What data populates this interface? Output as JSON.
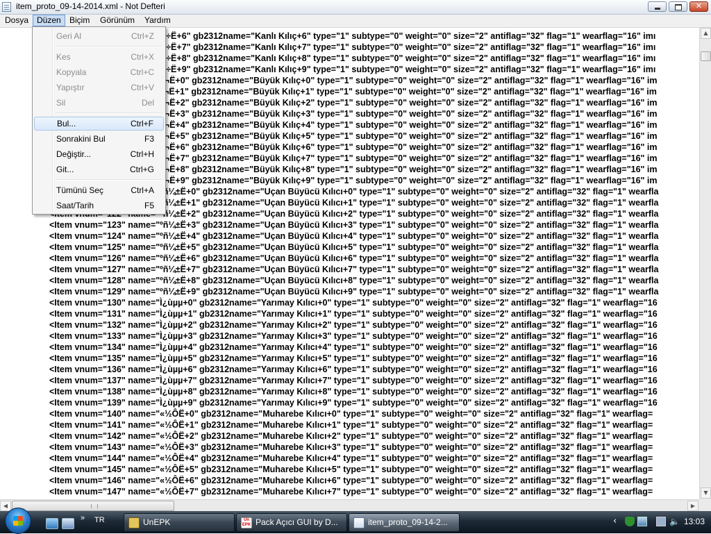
{
  "window": {
    "title": "item_proto_09-14-2014.xml - Not Defteri"
  },
  "menubar": [
    "Dosya",
    "Düzen",
    "Biçim",
    "Görünüm",
    "Yardım"
  ],
  "edit_menu": [
    {
      "label": "Geri Al",
      "shortcut": "Ctrl+Z",
      "state": "disabled"
    },
    {
      "label": "Kes",
      "shortcut": "Ctrl+X",
      "state": "disabled"
    },
    {
      "label": "Kopyala",
      "shortcut": "Ctrl+C",
      "state": "disabled"
    },
    {
      "label": "Yapıştır",
      "shortcut": "Ctrl+V",
      "state": "disabled"
    },
    {
      "label": "Sil",
      "shortcut": "Del",
      "state": "disabled"
    },
    {
      "label": "Bul...",
      "shortcut": "Ctrl+F",
      "state": "highlighted"
    },
    {
      "label": "Sonrakini Bul",
      "shortcut": "F3",
      "state": "enabled"
    },
    {
      "label": "Değiştir...",
      "shortcut": "Ctrl+H",
      "state": "enabled"
    },
    {
      "label": "Git...",
      "shortcut": "Ctrl+G",
      "state": "enabled"
    },
    {
      "label": "Tümünü Seç",
      "shortcut": "Ctrl+A",
      "state": "enabled"
    },
    {
      "label": "Saat/Tarih",
      "shortcut": "F5",
      "state": "enabled"
    }
  ],
  "editor_lines": [
    "<Item vnum=\"106\" name=\"Ç÷Ë+6\" gb2312name=\"Kanlı Kılıç+6\" type=\"1\" subtype=\"0\" weight=\"0\" size=\"2\" antiflag=\"32\" flag=\"1\" wearflag=\"16\" imı",
    "<Item vnum=\"107\" name=\"Ç÷Ë+7\" gb2312name=\"Kanlı Kılıç+7\" type=\"1\" subtype=\"0\" weight=\"0\" size=\"2\" antiflag=\"32\" flag=\"1\" wearflag=\"16\" imı",
    "<Item vnum=\"108\" name=\"Ç÷Ë+8\" gb2312name=\"Kanlı Kılıç+8\" type=\"1\" subtype=\"0\" weight=\"0\" size=\"2\" antiflag=\"32\" flag=\"1\" wearflag=\"16\" imı",
    "<Item vnum=\"109\" name=\"Ç÷Ë+9\" gb2312name=\"Kanlı Kılıç+9\" type=\"1\" subtype=\"0\" weight=\"0\" size=\"2\" antiflag=\"32\" flag=\"1\" wearflag=\"16\" imı",
    "<Item vnum=\"110\" name=\"¬¬Ë+0\" gb2312name=\"Büyük Kılıç+0\" type=\"1\" subtype=\"0\" weight=\"0\" size=\"2\" antiflag=\"32\" flag=\"1\" wearflag=\"16\" im",
    "<Item vnum=\"111\" name=\"¬¬Ë+1\" gb2312name=\"Büyük Kılıç+1\" type=\"1\" subtype=\"0\" weight=\"0\" size=\"2\" antiflag=\"32\" flag=\"1\" wearflag=\"16\" im",
    "<Item vnum=\"112\" name=\"¬¬Ë+2\" gb2312name=\"Büyük Kılıç+2\" type=\"1\" subtype=\"0\" weight=\"0\" size=\"2\" antiflag=\"32\" flag=\"1\" wearflag=\"16\" im",
    "<Item vnum=\"113\" name=\"¬¬Ë+3\" gb2312name=\"Büyük Kılıç+3\" type=\"1\" subtype=\"0\" weight=\"0\" size=\"2\" antiflag=\"32\" flag=\"1\" wearflag=\"16\" im",
    "<Item vnum=\"114\" name=\"¬¬Ë+4\" gb2312name=\"Büyük Kılıç+4\" type=\"1\" subtype=\"0\" weight=\"0\" size=\"2\" antiflag=\"32\" flag=\"1\" wearflag=\"16\" im",
    "<Item vnum=\"115\" name=\"¬¬Ë+5\" gb2312name=\"Büyük Kılıç+5\" type=\"1\" subtype=\"0\" weight=\"0\" size=\"2\" antiflag=\"32\" flag=\"1\" wearflag=\"16\" im",
    "<Item vnum=\"116\" name=\"¬¬Ë+6\" gb2312name=\"Büyük Kılıç+6\" type=\"1\" subtype=\"0\" weight=\"0\" size=\"2\" antiflag=\"32\" flag=\"1\" wearflag=\"16\" im",
    "<Item vnum=\"117\" name=\"¬¬Ë+7\" gb2312name=\"Büyük Kılıç+7\" type=\"1\" subtype=\"0\" weight=\"0\" size=\"2\" antiflag=\"32\" flag=\"1\" wearflag=\"16\" im",
    "<Item vnum=\"118\" name=\"¬¬Ë+8\" gb2312name=\"Büyük Kılıç+8\" type=\"1\" subtype=\"0\" weight=\"0\" size=\"2\" antiflag=\"32\" flag=\"1\" wearflag=\"16\" im",
    "<Item vnum=\"119\" name=\"¬¬Ë+9\" gb2312name=\"Büyük Kılıç+9\" type=\"1\" subtype=\"0\" weight=\"0\" size=\"2\" antiflag=\"32\" flag=\"1\" wearflag=\"16\" im",
    "<Item vnum=\"120\" name=\"ºñ¼±Ë+0\" gb2312name=\"Uçan Büyücü Kılıcı+0\" type=\"1\" subtype=\"0\" weight=\"0\" size=\"2\" antiflag=\"32\" flag=\"1\" wearfla",
    "<Item vnum=\"121\" name=\"ºñ¼±Ë+1\" gb2312name=\"Uçan Büyücü Kılıcı+1\" type=\"1\" subtype=\"0\" weight=\"0\" size=\"2\" antiflag=\"32\" flag=\"1\" wearfla",
    "<Item vnum=\"122\" name=\"ºñ¼±Ë+2\" gb2312name=\"Uçan Büyücü Kılıcı+2\" type=\"1\" subtype=\"0\" weight=\"0\" size=\"2\" antiflag=\"32\" flag=\"1\" wearfla",
    "<Item vnum=\"123\" name=\"ºñ¼±Ë+3\" gb2312name=\"Uçan Büyücü Kılıcı+3\" type=\"1\" subtype=\"0\" weight=\"0\" size=\"2\" antiflag=\"32\" flag=\"1\" wearfla",
    "<Item vnum=\"124\" name=\"ºñ¼±Ë+4\" gb2312name=\"Uçan Büyücü Kılıcı+4\" type=\"1\" subtype=\"0\" weight=\"0\" size=\"2\" antiflag=\"32\" flag=\"1\" wearfla",
    "<Item vnum=\"125\" name=\"ºñ¼±Ë+5\" gb2312name=\"Uçan Büyücü Kılıcı+5\" type=\"1\" subtype=\"0\" weight=\"0\" size=\"2\" antiflag=\"32\" flag=\"1\" wearfla",
    "<Item vnum=\"126\" name=\"ºñ¼±Ë+6\" gb2312name=\"Uçan Büyücü Kılıcı+6\" type=\"1\" subtype=\"0\" weight=\"0\" size=\"2\" antiflag=\"32\" flag=\"1\" wearfla",
    "<Item vnum=\"127\" name=\"ºñ¼±Ë+7\" gb2312name=\"Uçan Büyücü Kılıcı+7\" type=\"1\" subtype=\"0\" weight=\"0\" size=\"2\" antiflag=\"32\" flag=\"1\" wearfla",
    "<Item vnum=\"128\" name=\"ºñ¼±Ë+8\" gb2312name=\"Uçan Büyücü Kılıcı+8\" type=\"1\" subtype=\"0\" weight=\"0\" size=\"2\" antiflag=\"32\" flag=\"1\" wearfla",
    "<Item vnum=\"129\" name=\"ºñ¼±Ë+9\" gb2312name=\"Uçan Büyücü Kılıcı+9\" type=\"1\" subtype=\"0\" weight=\"0\" size=\"2\" antiflag=\"32\" flag=\"1\" wearfla",
    "<Item vnum=\"130\" name=\"Ì¿ùµµ+0\" gb2312name=\"Yarımay Kılıcı+0\" type=\"1\" subtype=\"0\" weight=\"0\" size=\"2\" antiflag=\"32\" flag=\"1\" wearflag=\"16",
    "<Item vnum=\"131\" name=\"Ì¿ùµµ+1\" gb2312name=\"Yarımay Kılıcı+1\" type=\"1\" subtype=\"0\" weight=\"0\" size=\"2\" antiflag=\"32\" flag=\"1\" wearflag=\"16",
    "<Item vnum=\"132\" name=\"Ì¿ùµµ+2\" gb2312name=\"Yarımay Kılıcı+2\" type=\"1\" subtype=\"0\" weight=\"0\" size=\"2\" antiflag=\"32\" flag=\"1\" wearflag=\"16",
    "<Item vnum=\"133\" name=\"Ì¿ùµµ+3\" gb2312name=\"Yarımay Kılıcı+3\" type=\"1\" subtype=\"0\" weight=\"0\" size=\"2\" antiflag=\"32\" flag=\"1\" wearflag=\"16",
    "<Item vnum=\"134\" name=\"Ì¿ùµµ+4\" gb2312name=\"Yarımay Kılıcı+4\" type=\"1\" subtype=\"0\" weight=\"0\" size=\"2\" antiflag=\"32\" flag=\"1\" wearflag=\"16",
    "<Item vnum=\"135\" name=\"Ì¿ùµµ+5\" gb2312name=\"Yarımay Kılıcı+5\" type=\"1\" subtype=\"0\" weight=\"0\" size=\"2\" antiflag=\"32\" flag=\"1\" wearflag=\"16",
    "<Item vnum=\"136\" name=\"Ì¿ùµµ+6\" gb2312name=\"Yarımay Kılıcı+6\" type=\"1\" subtype=\"0\" weight=\"0\" size=\"2\" antiflag=\"32\" flag=\"1\" wearflag=\"16",
    "<Item vnum=\"137\" name=\"Ì¿ùµµ+7\" gb2312name=\"Yarımay Kılıcı+7\" type=\"1\" subtype=\"0\" weight=\"0\" size=\"2\" antiflag=\"32\" flag=\"1\" wearflag=\"16",
    "<Item vnum=\"138\" name=\"Ì¿ùµµ+8\" gb2312name=\"Yarımay Kılıcı+8\" type=\"1\" subtype=\"0\" weight=\"0\" size=\"2\" antiflag=\"32\" flag=\"1\" wearflag=\"16",
    "<Item vnum=\"139\" name=\"Ì¿ùµµ+9\" gb2312name=\"Yarımay Kılıcı+9\" type=\"1\" subtype=\"0\" weight=\"0\" size=\"2\" antiflag=\"32\" flag=\"1\" wearflag=\"16",
    "<Item vnum=\"140\" name=\"«½ÔË+0\" gb2312name=\"Muharebe Kılıcı+0\" type=\"1\" subtype=\"0\" weight=\"0\" size=\"2\" antiflag=\"32\" flag=\"1\" wearflag=",
    "<Item vnum=\"141\" name=\"«½ÔË+1\" gb2312name=\"Muharebe Kılıcı+1\" type=\"1\" subtype=\"0\" weight=\"0\" size=\"2\" antiflag=\"32\" flag=\"1\" wearflag=",
    "<Item vnum=\"142\" name=\"«½ÔË+2\" gb2312name=\"Muharebe Kılıcı+2\" type=\"1\" subtype=\"0\" weight=\"0\" size=\"2\" antiflag=\"32\" flag=\"1\" wearflag=",
    "<Item vnum=\"143\" name=\"«½ÔË+3\" gb2312name=\"Muharebe Kılıcı+3\" type=\"1\" subtype=\"0\" weight=\"0\" size=\"2\" antiflag=\"32\" flag=\"1\" wearflag=",
    "<Item vnum=\"144\" name=\"«½ÔË+4\" gb2312name=\"Muharebe Kılıcı+4\" type=\"1\" subtype=\"0\" weight=\"0\" size=\"2\" antiflag=\"32\" flag=\"1\" wearflag=",
    "<Item vnum=\"145\" name=\"«½ÔË+5\" gb2312name=\"Muharebe Kılıcı+5\" type=\"1\" subtype=\"0\" weight=\"0\" size=\"2\" antiflag=\"32\" flag=\"1\" wearflag=",
    "<Item vnum=\"146\" name=\"«½ÔË+6\" gb2312name=\"Muharebe Kılıcı+6\" type=\"1\" subtype=\"0\" weight=\"0\" size=\"2\" antiflag=\"32\" flag=\"1\" wearflag=",
    "<Item vnum=\"147\" name=\"«½ÔË+7\" gb2312name=\"Muharebe Kılıcı+7\" type=\"1\" subtype=\"0\" weight=\"0\" size=\"2\" antiflag=\"32\" flag=\"1\" wearflag="
  ],
  "taskbar": {
    "language": "TR",
    "quick_launch_more": "»",
    "tasks": [
      {
        "label": "UnEPK",
        "icon": "archive-icon",
        "active": false
      },
      {
        "label": "Pack Açıcı GUI by D...",
        "icon": "unepk-icon",
        "active": false
      },
      {
        "label": "item_proto_09-14-2...",
        "icon": "notepad-icon",
        "active": true
      }
    ],
    "task2_icon_text": "Un EPK",
    "tray_chevron": "‹",
    "clock": "13:03"
  }
}
